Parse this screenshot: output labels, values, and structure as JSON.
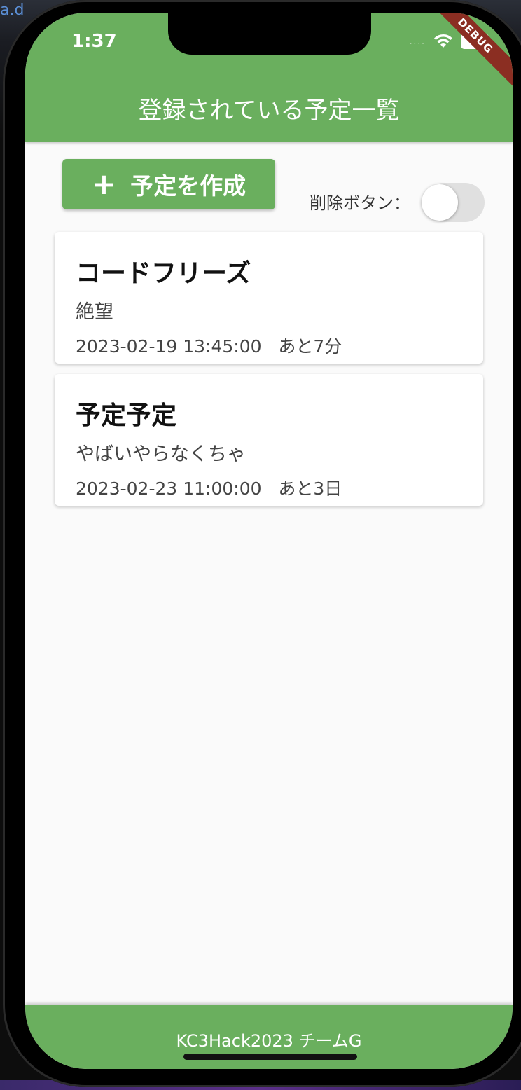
{
  "status_bar": {
    "time": "1:37",
    "signal_dots": "....",
    "wifi_icon": "wifi-icon",
    "battery_icon": "battery-icon"
  },
  "debug_banner": "DEBUG",
  "app_bar": {
    "title": "登録されている予定一覧"
  },
  "toolbar": {
    "create_icon": "plus-icon",
    "create_label": "予定を作成",
    "delete_toggle_label": "削除ボタン：",
    "delete_toggle_on": false
  },
  "events": [
    {
      "title": "コードフリーズ",
      "description": "絶望",
      "datetime": "2023-02-19 13:45:00",
      "remaining": "あと7分"
    },
    {
      "title": "予定予定",
      "description": "やばいやらなくちゃ",
      "datetime": "2023-02-23 11:00:00",
      "remaining": "あと3日"
    }
  ],
  "footer": {
    "text": "KC3Hack2023 チームG"
  },
  "colors": {
    "brand_green": "#6aaf5e",
    "debug_red": "#8b2e22",
    "background": "#fafafa"
  }
}
